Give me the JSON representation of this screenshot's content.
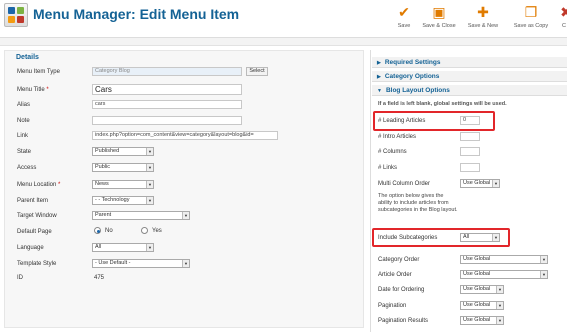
{
  "header": {
    "title": "Menu Manager: Edit Menu Item",
    "toolbar": [
      {
        "label": "Save",
        "icon": "save-icon"
      },
      {
        "label": "Save & Close",
        "icon": "save-close-icon"
      },
      {
        "label": "Save & New",
        "icon": "save-new-icon"
      },
      {
        "label": "Save as Copy",
        "icon": "save-copy-icon"
      },
      {
        "label": "C",
        "icon": "close-icon"
      }
    ]
  },
  "details": {
    "title": "Details",
    "fields": {
      "menu_item_type": {
        "label": "Menu Item Type",
        "value": "Category Blog",
        "button": "Select"
      },
      "menu_title": {
        "label": "Menu Title",
        "value": "Cars"
      },
      "alias": {
        "label": "Alias",
        "value": "cars"
      },
      "note": {
        "label": "Note",
        "value": ""
      },
      "link": {
        "label": "Link",
        "value": "index.php?option=com_content&view=category&layout=blog&id="
      },
      "state": {
        "label": "State",
        "value": "Published"
      },
      "access": {
        "label": "Access",
        "value": "Public"
      },
      "menu_location": {
        "label": "Menu Location",
        "value": "News"
      },
      "parent_item": {
        "label": "Parent Item",
        "value": "- - Technology"
      },
      "target_window": {
        "label": "Target Window",
        "value": "Parent"
      },
      "default_page": {
        "label": "Default Page",
        "no": "No",
        "yes": "Yes"
      },
      "language": {
        "label": "Language",
        "value": "All"
      },
      "template_style": {
        "label": "Template Style",
        "value": "- Use Default -"
      },
      "id": {
        "label": "ID",
        "value": "475"
      }
    }
  },
  "right": {
    "sections": [
      "Required Settings",
      "Category Options",
      "Blog Layout Options"
    ],
    "note": "If a field is left blank, global settings will be used.",
    "fields": {
      "leading_articles": {
        "label": "# Leading Articles",
        "value": "0"
      },
      "intro_articles": {
        "label": "# Intro Articles",
        "value": ""
      },
      "columns": {
        "label": "# Columns",
        "value": ""
      },
      "links": {
        "label": "# Links",
        "value": ""
      },
      "multi_column_order": {
        "label": "Multi Column Order",
        "value": "Use Global"
      },
      "subcat_note": "The option below gives the ability to include articles from subcategories in the Blog layout.",
      "include_subcategories": {
        "label": "Include Subcategories",
        "value": "All"
      },
      "category_order": {
        "label": "Category Order",
        "value": "Use Global"
      },
      "article_order": {
        "label": "Article Order",
        "value": "Use Global"
      },
      "date_for_ordering": {
        "label": "Date for Ordering",
        "value": "Use Global"
      },
      "pagination": {
        "label": "Pagination",
        "value": "Use Global"
      },
      "pagination_results": {
        "label": "Pagination Results",
        "value": "Use Global"
      }
    }
  },
  "colors": {
    "accent": "#146295",
    "highlight": "#e2262a",
    "toolbar_icon": "#e07b00"
  }
}
